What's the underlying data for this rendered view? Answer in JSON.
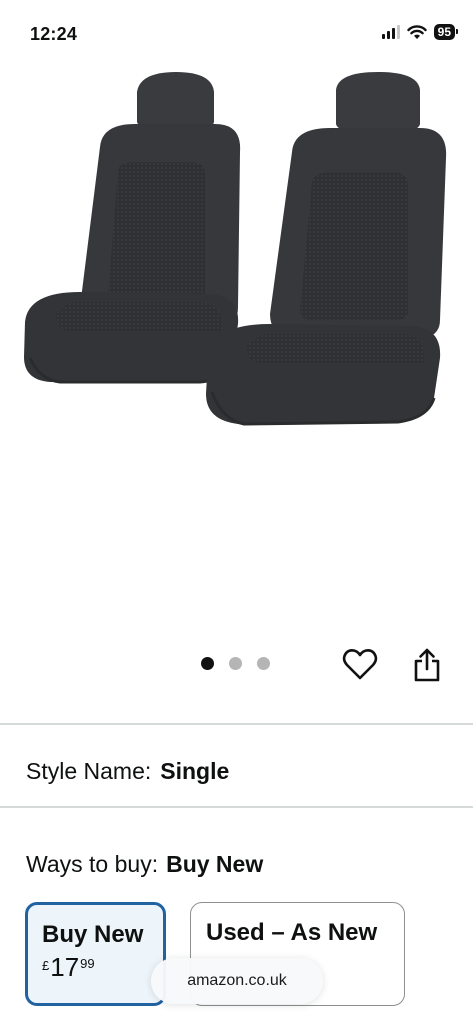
{
  "status_bar": {
    "time": "12:24",
    "battery": "95",
    "signal_icon": "cellular-signal-icon",
    "wifi_icon": "wifi-icon"
  },
  "gallery": {
    "image": "black-car-seat-covers",
    "dots_count": 3,
    "active_dot": 0,
    "wishlist_icon": "heart-icon",
    "share_icon": "share-icon"
  },
  "style": {
    "label": "Style Name:",
    "value": "Single"
  },
  "ways_to_buy": {
    "label": "Ways to buy:",
    "value": "Buy New"
  },
  "options": {
    "buy_new": {
      "title": "Buy New",
      "currency": "£",
      "price_whole": "17",
      "price_fraction": "99"
    },
    "used": {
      "title": "Used – As New"
    }
  },
  "browser": {
    "url": "amazon.co.uk"
  },
  "colors": {
    "selected_border": "#2162a1",
    "selected_bg": "#edf5fb",
    "divider": "#d5d9d9"
  }
}
